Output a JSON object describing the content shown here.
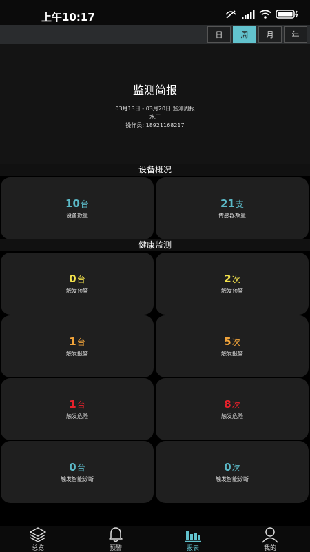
{
  "status_bar": {
    "time": "上午10:17"
  },
  "period_tabs": [
    {
      "label": "日"
    },
    {
      "label": "周"
    },
    {
      "label": "月"
    },
    {
      "label": "年"
    }
  ],
  "report": {
    "title": "监测简报",
    "date_range": "03月13日 - 03月20日 监测周报",
    "site": "水厂",
    "operator": "操作员: 18921168217"
  },
  "equipment_section": {
    "title": "设备概况",
    "cards": [
      {
        "value": "10",
        "unit": "台",
        "label": "设备数量",
        "color": "#5bb8c6"
      },
      {
        "value": "21",
        "unit": "支",
        "label": "传感器数量",
        "color": "#5bb8c6"
      }
    ]
  },
  "health_section": {
    "title": "健康监测",
    "cards": [
      {
        "value": "0",
        "unit": "台",
        "label": "触发预警",
        "color": "#f2e14b"
      },
      {
        "value": "2",
        "unit": "次",
        "label": "触发预警",
        "color": "#f2e14b"
      },
      {
        "value": "1",
        "unit": "台",
        "label": "触发报警",
        "color": "#f0a33a"
      },
      {
        "value": "5",
        "unit": "次",
        "label": "触发报警",
        "color": "#f0a33a"
      },
      {
        "value": "1",
        "unit": "台",
        "label": "触发危险",
        "color": "#e8212b"
      },
      {
        "value": "8",
        "unit": "次",
        "label": "触发危险",
        "color": "#e8212b"
      },
      {
        "value": "0",
        "unit": "台",
        "label": "触发智能诊断",
        "color": "#5bb8c6"
      },
      {
        "value": "0",
        "unit": "次",
        "label": "触发智能诊断",
        "color": "#5bb8c6"
      }
    ]
  },
  "tab_bar": [
    {
      "label": "总览",
      "icon": "layers-icon"
    },
    {
      "label": "预警",
      "icon": "bell-icon"
    },
    {
      "label": "报表",
      "icon": "bar-chart-icon"
    },
    {
      "label": "我的",
      "icon": "user-icon"
    }
  ],
  "colors": {
    "accent": "#62c2cd",
    "background": "#000000",
    "card": "#1f1f1f"
  }
}
